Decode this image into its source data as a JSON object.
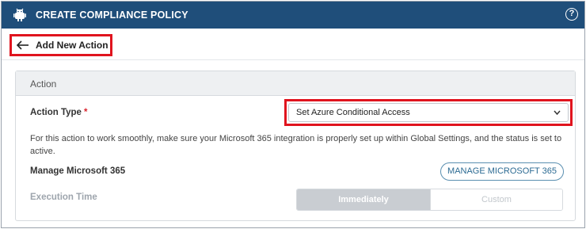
{
  "header": {
    "title": "CREATE COMPLIANCE POLICY",
    "help_icon": "help-circle-icon",
    "logo_icon": "android-robot-icon",
    "bg_color": "#1f4e7a"
  },
  "subheader": {
    "back_label": "Add New Action",
    "back_icon": "arrow-left-icon"
  },
  "card": {
    "title": "Action",
    "action_type_label": "Action Type",
    "required_marker": "*",
    "action_type_value": "Set Azure Conditional Access",
    "note": "For this action to work smoothly, make sure your Microsoft 365 integration is properly set up within Global Settings, and the status is set to active.",
    "manage_label": "Manage Microsoft 365",
    "manage_button": "MANAGE MICROSOFT 365",
    "execution_label": "Execution Time",
    "execution_options": [
      "Immediately",
      "Custom"
    ],
    "execution_selected": "Immediately"
  },
  "colors": {
    "highlight": "#e0141e",
    "required": "#d9232d",
    "button_text": "#2c6b93"
  }
}
